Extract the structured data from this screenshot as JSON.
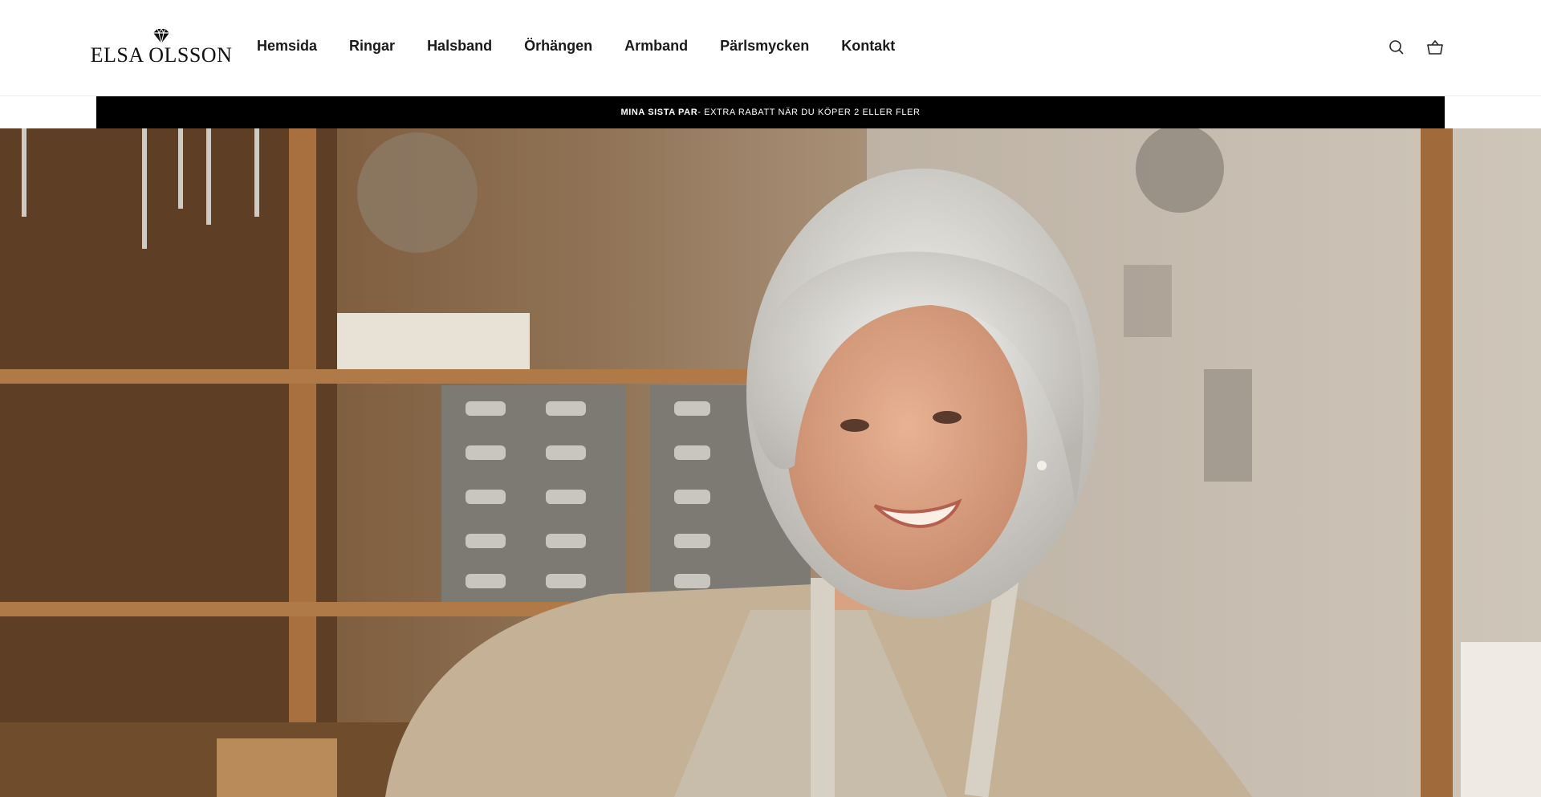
{
  "brand": {
    "name": "ELSA OLSSON"
  },
  "nav": {
    "items": [
      {
        "label": "Hemsida"
      },
      {
        "label": "Ringar"
      },
      {
        "label": "Halsband"
      },
      {
        "label": "Örhängen"
      },
      {
        "label": "Armband"
      },
      {
        "label": "Pärlsmycken"
      },
      {
        "label": "Kontakt"
      }
    ]
  },
  "header_icons": {
    "search": "search-icon",
    "cart": "shopping-basket-icon"
  },
  "announcement": {
    "highlight": "MINA SISTA PAR",
    "text": " - EXTRA RABATT NÄR DU KÖPER 2 ELLER FLER"
  },
  "hero": {
    "image": "jeweler-woman-in-workshop-photo"
  },
  "colors": {
    "announcement_bg": "#000000",
    "header_bg": "#ffffff",
    "text": "#1a1a1a"
  }
}
